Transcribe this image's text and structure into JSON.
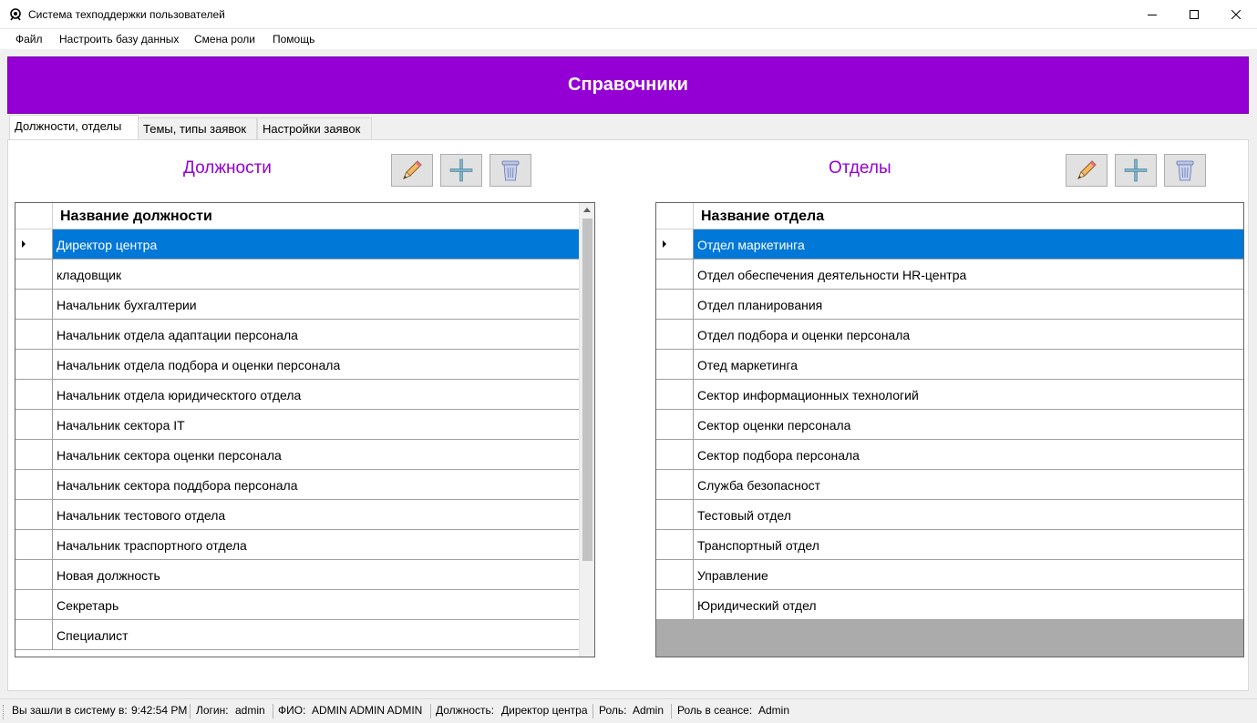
{
  "window": {
    "title": "Система техподдержки пользователей",
    "app_icon": "gear-user-icon",
    "controls": [
      "minimize-icon",
      "maximize-icon",
      "close-icon"
    ]
  },
  "menu": {
    "items": [
      "Файл",
      "Настроить базу данных",
      "Смена роли",
      "Помощь"
    ]
  },
  "banner": {
    "title": "Справочники",
    "color": "#9400d3"
  },
  "tabs": [
    {
      "label": "Должности, отделы",
      "active": true
    },
    {
      "label": "Темы, типы заявок",
      "active": false
    },
    {
      "label": "Настройки заявок",
      "active": false
    }
  ],
  "positions": {
    "title": "Должности",
    "column_header": "Название должности",
    "selected_index": 0,
    "rows": [
      "Директор центра",
      "кладовщик",
      "Начальник бухгалтерии",
      "Начальник отдела адаптации персонала",
      "Начальник отдела подбора и оценки персонала",
      "Начальник отдела юридическтого отдела",
      "Начальник сектора IT",
      "Начальник сектора оценки персонала",
      "Начальник сектора поддбора персонала",
      "Начальник тестового отдела",
      "Начальник траспортного отдела",
      "Новая должность",
      "Секретарь",
      "Специалист"
    ]
  },
  "departments": {
    "title": "Отделы",
    "column_header": "Название отдела",
    "selected_index": 0,
    "rows": [
      "Отдел маркетинга",
      "Отдел обеспечения деятельности HR-центра",
      "Отдел планирования",
      "Отдел подбора и оценки персонала",
      "Отед маркетинга",
      "Сектор информационных технологий",
      "Сектор оценки персонала",
      "Сектор подбора персонала",
      "Служба безопасност",
      "Тестовый отдел",
      "Транспортный отдел",
      "Управление",
      "Юридический отдел"
    ]
  },
  "toolbar_icons": [
    "edit-pencil-icon",
    "add-plus-icon",
    "delete-trash-icon"
  ],
  "accent_color": "#9400d3",
  "selection_color": "#0078d7",
  "status": {
    "login_time_label": "Вы зашли в систему в:",
    "login_time": "9:42:54 PM",
    "login_label": "Логин:",
    "login": "admin",
    "fio_label": "ФИО:",
    "fio": "ADMIN ADMIN ADMIN",
    "position_label": "Должность:",
    "position": "Директор центра",
    "role_label": "Роль:",
    "role": "Admin",
    "session_role_label": "Роль в сеансе:",
    "session_role": "Admin"
  }
}
